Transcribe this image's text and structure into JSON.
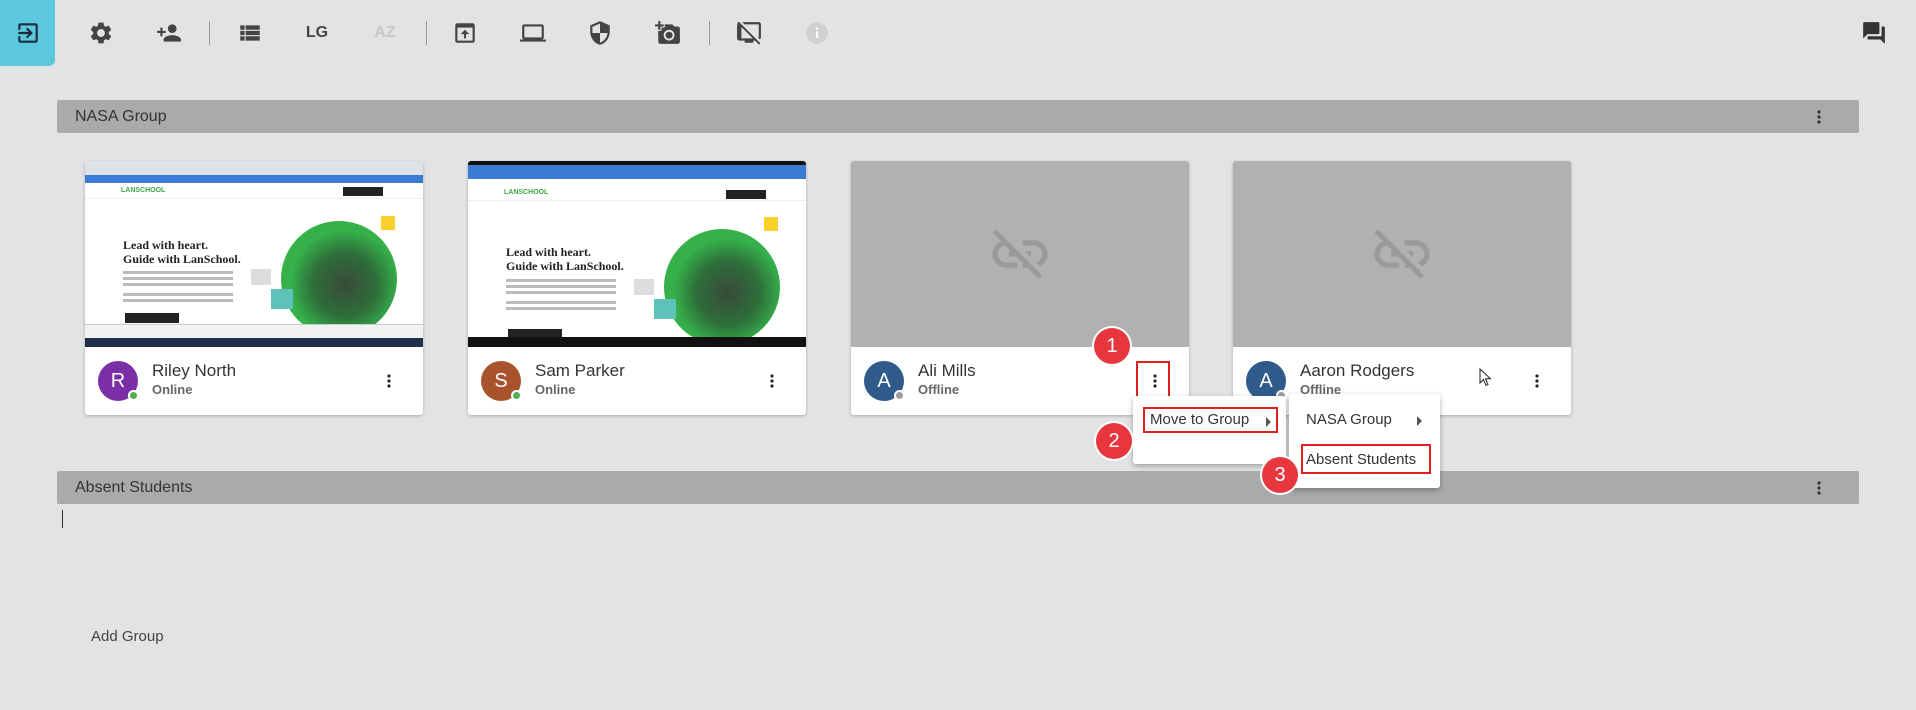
{
  "toolbar": {
    "lg_label": "LG",
    "az_label": "AZ",
    "icons": [
      "exit-icon",
      "settings-gear-icon",
      "add-user-icon",
      "list-view-icon",
      "lg-toggle",
      "az-sort",
      "share-screen-icon",
      "laptop-icon",
      "shield-icon",
      "add-photo-icon",
      "blank-screen-icon",
      "info-icon",
      "chat-icon"
    ]
  },
  "groups": [
    {
      "title": "NASA Group",
      "students": [
        {
          "name": "Riley North",
          "status": "Online",
          "initial": "R",
          "avatar_color": "#7b2fa6",
          "status_color": "#4caf50",
          "thumbnail": "web-page"
        },
        {
          "name": "Sam Parker",
          "status": "Online",
          "initial": "S",
          "avatar_color": "#a9532d",
          "status_color": "#4caf50",
          "thumbnail": "web-page"
        },
        {
          "name": "Ali Mills",
          "status": "Offline",
          "initial": "A",
          "avatar_color": "#2f5a8a",
          "status_color": "#9e9e9e",
          "thumbnail": "disconnected"
        },
        {
          "name": "Aaron Rodgers",
          "status": "Offline",
          "initial": "A",
          "avatar_color": "#2f5a8a",
          "status_color": "#9e9e9e",
          "thumbnail": "disconnected"
        }
      ]
    },
    {
      "title": "Absent Students",
      "students": []
    }
  ],
  "thumbnail_page": {
    "headline_line1": "Lead with heart.",
    "headline_line2": "Guide with LanSchool.",
    "logo_text": "LANSCHOOL"
  },
  "context_menu": {
    "item": "Move to Group"
  },
  "submenu": {
    "items": [
      "NASA Group",
      "Absent Students"
    ]
  },
  "callouts": [
    "1",
    "2",
    "3"
  ],
  "add_group_label": "Add Group"
}
